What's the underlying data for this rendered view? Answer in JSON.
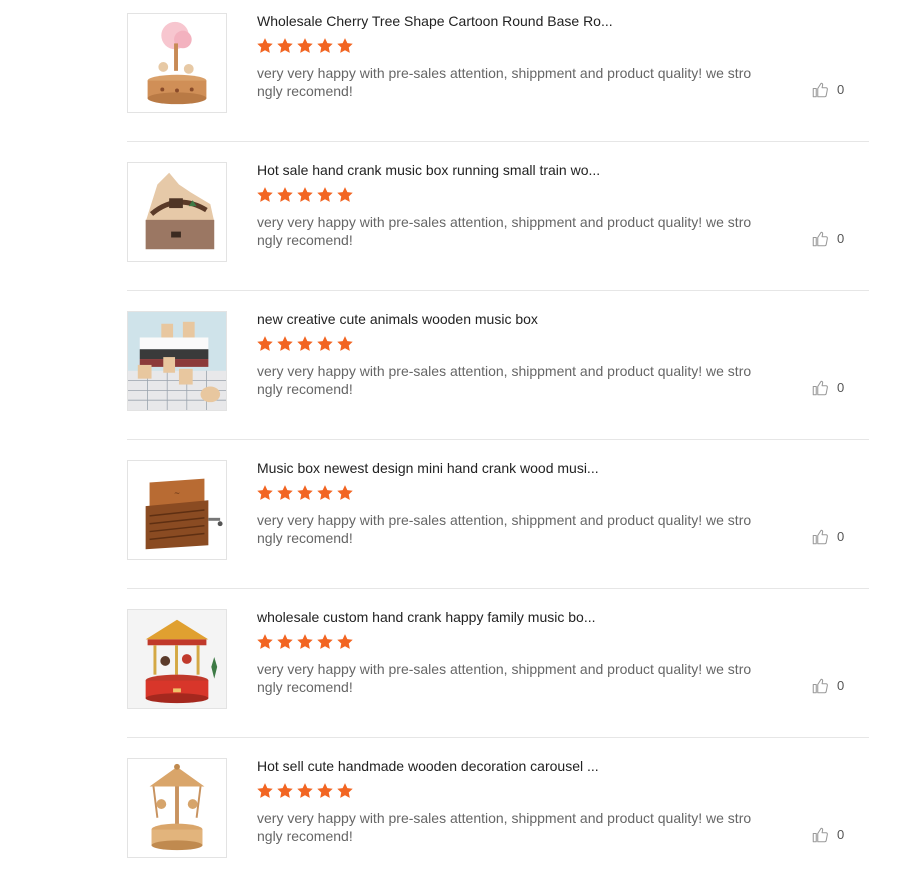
{
  "colors": {
    "star": "#f26522",
    "divider": "#e6e6e6",
    "title": "#222222",
    "comment": "#666666"
  },
  "reviews": [
    {
      "title": "Wholesale Cherry Tree Shape Cartoon Round Base Ro...",
      "rating": 5,
      "comment": "very very happy with pre-sales attention, shippment and product quality! we strongly recomend!",
      "likes": "0",
      "like_icon": "thumbs-up-icon"
    },
    {
      "title": "Hot sale hand crank music box running small train wo...",
      "rating": 5,
      "comment": "very very happy with pre-sales attention, shippment and product quality! we strongly recomend!",
      "likes": "0",
      "like_icon": "thumbs-up-icon"
    },
    {
      "title": "new creative cute animals wooden music box",
      "rating": 5,
      "comment": "very very happy with pre-sales attention, shippment and product quality! we strongly recomend!",
      "likes": "0",
      "like_icon": "thumbs-up-icon"
    },
    {
      "title": "Music box newest design mini hand crank wood musi...",
      "rating": 5,
      "comment": "very very happy with pre-sales attention, shippment and product quality! we strongly recomend!",
      "likes": "0",
      "like_icon": "thumbs-up-icon"
    },
    {
      "title": "wholesale custom hand crank happy family music bo...",
      "rating": 5,
      "comment": "very very happy with pre-sales attention, shippment and product quality! we strongly recomend!",
      "likes": "0",
      "like_icon": "thumbs-up-icon"
    },
    {
      "title": "Hot sell cute handmade wooden decoration carousel ...",
      "rating": 5,
      "comment": "very very happy with pre-sales attention, shippment and product quality! we strongly recomend!",
      "likes": "0",
      "like_icon": "thumbs-up-icon"
    }
  ]
}
